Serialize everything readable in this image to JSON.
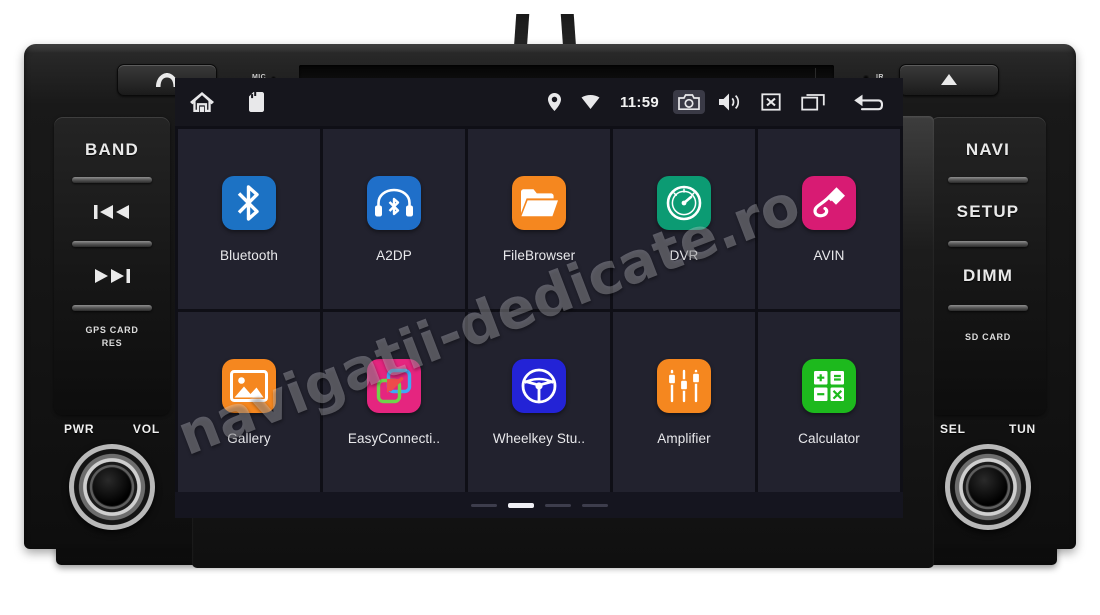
{
  "device": {
    "top_bezel": {
      "phone_button": "phone",
      "eject_button": "eject",
      "mic_label": "MIC",
      "ir_label": "IR",
      "cd_slot": "CD slot"
    },
    "left_panel": {
      "buttons": [
        {
          "label": "BAND",
          "name": "band-button"
        },
        {
          "label": "prev-track",
          "name": "prev-track-button"
        },
        {
          "label": "next-track",
          "name": "next-track-button"
        }
      ],
      "footer_line1": "GPS CARD",
      "footer_line2": "RES"
    },
    "right_panel": {
      "buttons": [
        {
          "label": "NAVI",
          "name": "navi-button"
        },
        {
          "label": "SETUP",
          "name": "setup-button"
        },
        {
          "label": "DIMM",
          "name": "dimm-button"
        }
      ],
      "footer_line1": "SD CARD"
    },
    "left_knob": {
      "label_left": "PWR",
      "label_right": "VOL"
    },
    "right_knob": {
      "label_left": "SEL",
      "label_right": "TUN"
    }
  },
  "screen": {
    "statusbar": {
      "home_icon": "home-icon",
      "sdcard_icon": "sdcard-icon",
      "location_icon": "location-pin-icon",
      "wifi_icon": "wifi-icon",
      "time": "11:59",
      "camera_icon": "camera-icon",
      "volume_icon": "volume-icon",
      "mute_icon": "mute-box-icon",
      "recents_icon": "recent-apps-icon",
      "back_icon": "back-arrow-icon"
    },
    "apps": [
      {
        "label": "Bluetooth",
        "icon": "bluetooth-icon",
        "color": "#1c72c4"
      },
      {
        "label": "A2DP",
        "icon": "headset-bluetooth-icon",
        "color": "#1f6fc9"
      },
      {
        "label": "FileBrowser",
        "icon": "folder-icon",
        "color": "#f5871f"
      },
      {
        "label": "DVR",
        "icon": "gauge-icon",
        "color": "#0c9b73"
      },
      {
        "label": "AVIN",
        "icon": "av-plug-icon",
        "color": "#d81b73"
      },
      {
        "label": "Gallery",
        "icon": "photo-icon",
        "color": "#f5871f"
      },
      {
        "label": "EasyConnecti..",
        "icon": "easyconnect-icon",
        "color": "#e5257f"
      },
      {
        "label": "Wheelkey Stu..",
        "icon": "steering-wheel-icon",
        "color": "#2323d6"
      },
      {
        "label": "Amplifier",
        "icon": "equalizer-icon",
        "color": "#f5871f"
      },
      {
        "label": "Calculator",
        "icon": "calculator-icon",
        "color": "#1db91d"
      }
    ],
    "pager": {
      "count": 4,
      "active_index": 1
    },
    "watermark": "navigatii-dedicate.ro"
  }
}
